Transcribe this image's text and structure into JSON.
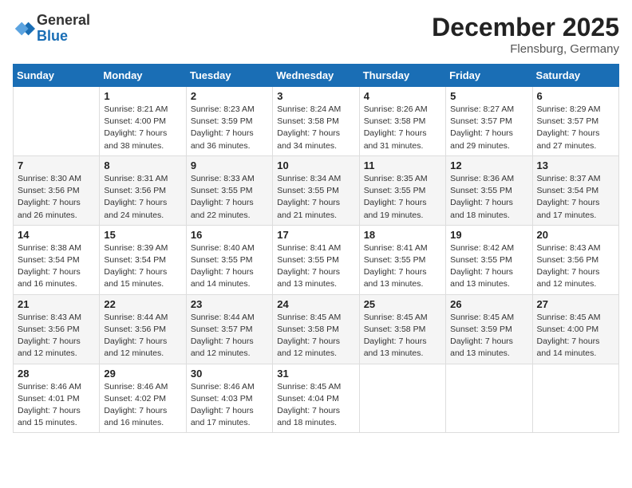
{
  "logo": {
    "general": "General",
    "blue": "Blue"
  },
  "title": "December 2025",
  "location": "Flensburg, Germany",
  "weekdays": [
    "Sunday",
    "Monday",
    "Tuesday",
    "Wednesday",
    "Thursday",
    "Friday",
    "Saturday"
  ],
  "weeks": [
    [
      {
        "day": "",
        "content": ""
      },
      {
        "day": "1",
        "content": "Sunrise: 8:21 AM\nSunset: 4:00 PM\nDaylight: 7 hours\nand 38 minutes."
      },
      {
        "day": "2",
        "content": "Sunrise: 8:23 AM\nSunset: 3:59 PM\nDaylight: 7 hours\nand 36 minutes."
      },
      {
        "day": "3",
        "content": "Sunrise: 8:24 AM\nSunset: 3:58 PM\nDaylight: 7 hours\nand 34 minutes."
      },
      {
        "day": "4",
        "content": "Sunrise: 8:26 AM\nSunset: 3:58 PM\nDaylight: 7 hours\nand 31 minutes."
      },
      {
        "day": "5",
        "content": "Sunrise: 8:27 AM\nSunset: 3:57 PM\nDaylight: 7 hours\nand 29 minutes."
      },
      {
        "day": "6",
        "content": "Sunrise: 8:29 AM\nSunset: 3:57 PM\nDaylight: 7 hours\nand 27 minutes."
      }
    ],
    [
      {
        "day": "7",
        "content": "Sunrise: 8:30 AM\nSunset: 3:56 PM\nDaylight: 7 hours\nand 26 minutes."
      },
      {
        "day": "8",
        "content": "Sunrise: 8:31 AM\nSunset: 3:56 PM\nDaylight: 7 hours\nand 24 minutes."
      },
      {
        "day": "9",
        "content": "Sunrise: 8:33 AM\nSunset: 3:55 PM\nDaylight: 7 hours\nand 22 minutes."
      },
      {
        "day": "10",
        "content": "Sunrise: 8:34 AM\nSunset: 3:55 PM\nDaylight: 7 hours\nand 21 minutes."
      },
      {
        "day": "11",
        "content": "Sunrise: 8:35 AM\nSunset: 3:55 PM\nDaylight: 7 hours\nand 19 minutes."
      },
      {
        "day": "12",
        "content": "Sunrise: 8:36 AM\nSunset: 3:55 PM\nDaylight: 7 hours\nand 18 minutes."
      },
      {
        "day": "13",
        "content": "Sunrise: 8:37 AM\nSunset: 3:54 PM\nDaylight: 7 hours\nand 17 minutes."
      }
    ],
    [
      {
        "day": "14",
        "content": "Sunrise: 8:38 AM\nSunset: 3:54 PM\nDaylight: 7 hours\nand 16 minutes."
      },
      {
        "day": "15",
        "content": "Sunrise: 8:39 AM\nSunset: 3:54 PM\nDaylight: 7 hours\nand 15 minutes."
      },
      {
        "day": "16",
        "content": "Sunrise: 8:40 AM\nSunset: 3:55 PM\nDaylight: 7 hours\nand 14 minutes."
      },
      {
        "day": "17",
        "content": "Sunrise: 8:41 AM\nSunset: 3:55 PM\nDaylight: 7 hours\nand 13 minutes."
      },
      {
        "day": "18",
        "content": "Sunrise: 8:41 AM\nSunset: 3:55 PM\nDaylight: 7 hours\nand 13 minutes."
      },
      {
        "day": "19",
        "content": "Sunrise: 8:42 AM\nSunset: 3:55 PM\nDaylight: 7 hours\nand 13 minutes."
      },
      {
        "day": "20",
        "content": "Sunrise: 8:43 AM\nSunset: 3:56 PM\nDaylight: 7 hours\nand 12 minutes."
      }
    ],
    [
      {
        "day": "21",
        "content": "Sunrise: 8:43 AM\nSunset: 3:56 PM\nDaylight: 7 hours\nand 12 minutes."
      },
      {
        "day": "22",
        "content": "Sunrise: 8:44 AM\nSunset: 3:56 PM\nDaylight: 7 hours\nand 12 minutes."
      },
      {
        "day": "23",
        "content": "Sunrise: 8:44 AM\nSunset: 3:57 PM\nDaylight: 7 hours\nand 12 minutes."
      },
      {
        "day": "24",
        "content": "Sunrise: 8:45 AM\nSunset: 3:58 PM\nDaylight: 7 hours\nand 12 minutes."
      },
      {
        "day": "25",
        "content": "Sunrise: 8:45 AM\nSunset: 3:58 PM\nDaylight: 7 hours\nand 13 minutes."
      },
      {
        "day": "26",
        "content": "Sunrise: 8:45 AM\nSunset: 3:59 PM\nDaylight: 7 hours\nand 13 minutes."
      },
      {
        "day": "27",
        "content": "Sunrise: 8:45 AM\nSunset: 4:00 PM\nDaylight: 7 hours\nand 14 minutes."
      }
    ],
    [
      {
        "day": "28",
        "content": "Sunrise: 8:46 AM\nSunset: 4:01 PM\nDaylight: 7 hours\nand 15 minutes."
      },
      {
        "day": "29",
        "content": "Sunrise: 8:46 AM\nSunset: 4:02 PM\nDaylight: 7 hours\nand 16 minutes."
      },
      {
        "day": "30",
        "content": "Sunrise: 8:46 AM\nSunset: 4:03 PM\nDaylight: 7 hours\nand 17 minutes."
      },
      {
        "day": "31",
        "content": "Sunrise: 8:45 AM\nSunset: 4:04 PM\nDaylight: 7 hours\nand 18 minutes."
      },
      {
        "day": "",
        "content": ""
      },
      {
        "day": "",
        "content": ""
      },
      {
        "day": "",
        "content": ""
      }
    ]
  ]
}
